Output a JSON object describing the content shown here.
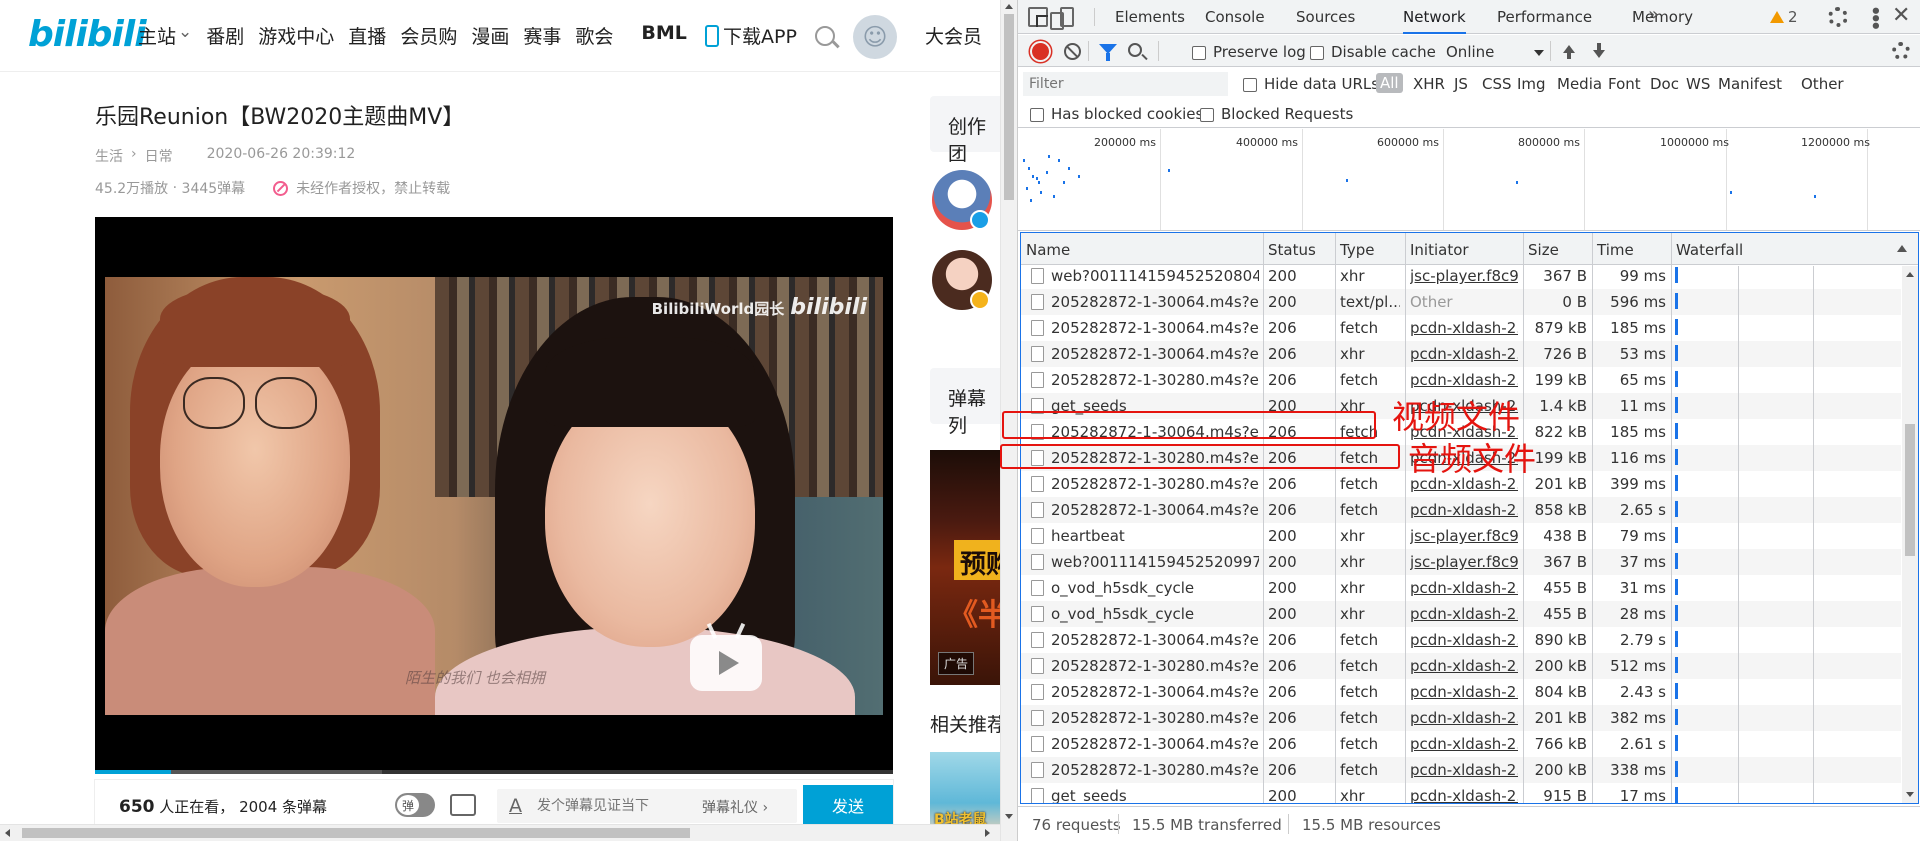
{
  "site": {
    "logo": "bilibili",
    "nav": [
      "主站",
      "番剧",
      "游戏中心",
      "直播",
      "会员购",
      "漫画",
      "赛事",
      "歌会"
    ],
    "nav_bml": "BML",
    "download_app": "下载APP",
    "vip": "大会员",
    "video": {
      "title": "乐园Reunion【BW2020主题曲MV】",
      "category": "生活",
      "subcategory": "日常",
      "date": "2020-06-26 20:39:12",
      "plays": "45.2万播放",
      "danmaku_count": "3445弹幕",
      "copyright": "未经作者授权，禁止转载",
      "watermark_text": "BilibiliWorld园长",
      "watermark_logo": "bilibili",
      "subtitle_overlay": "陌生的我们 也会相拥",
      "progress_fraction": 0.095,
      "buffer_fraction": 0.36
    },
    "danmaku_bar": {
      "watching_count": "650",
      "watching_text": "人正在看，",
      "danmaku_total": "2004 条弹幕",
      "toggle_label": "弹",
      "input_icon": "A",
      "input_placeholder": "发个弹幕见证当下",
      "etiquette": "弹幕礼仪 ›",
      "send": "发送"
    },
    "right_column": {
      "creation_team": "创作团",
      "danmaku_list": "弹幕列",
      "ad_text_1": "预购",
      "ad_text_2": "《半",
      "ad_tag": "广告",
      "related": "相关推荐",
      "related_thumb_text": "B站老鼠"
    }
  },
  "devtools": {
    "tabs": [
      "Elements",
      "Console",
      "Sources",
      "Network",
      "Performance",
      "Memory"
    ],
    "active_tab": "Network",
    "more_tabs": "»",
    "warnings": "2",
    "toolbar": {
      "preserve_log": "Preserve log",
      "disable_cache": "Disable cache",
      "throttling": "Online"
    },
    "filter": {
      "placeholder": "Filter",
      "hide_data_urls": "Hide data URLs",
      "types": [
        "All",
        "XHR",
        "JS",
        "CSS",
        "Img",
        "Media",
        "Font",
        "Doc",
        "WS",
        "Manifest",
        "Other"
      ],
      "has_blocked_cookies": "Has blocked cookies",
      "blocked_requests": "Blocked Requests"
    },
    "overview_labels": [
      "200000 ms",
      "400000 ms",
      "600000 ms",
      "800000 ms",
      "1000000 ms",
      "1200000 ms"
    ],
    "columns": [
      "Name",
      "Status",
      "Type",
      "Initiator",
      "Size",
      "Time",
      "Waterfall"
    ],
    "requests": [
      {
        "name": "web?0011141594525208047...",
        "status": "200",
        "type": "xhr",
        "initiator": "jsc-player.f8c9...",
        "size": "367 B",
        "time": "99 ms"
      },
      {
        "name": "205282872-1-30064.m4s?exp...",
        "status": "200",
        "type": "text/pl...",
        "initiator": "Other",
        "size": "0 B",
        "time": "596 ms"
      },
      {
        "name": "205282872-1-30064.m4s?exp...",
        "status": "206",
        "type": "fetch",
        "initiator": "pcdn-xldash-2...",
        "size": "879 kB",
        "time": "185 ms"
      },
      {
        "name": "205282872-1-30064.m4s?exp...",
        "status": "206",
        "type": "xhr",
        "initiator": "pcdn-xldash-2...",
        "size": "726 B",
        "time": "53 ms"
      },
      {
        "name": "205282872-1-30280.m4s?exp...",
        "status": "206",
        "type": "fetch",
        "initiator": "pcdn-xldash-2...",
        "size": "199 kB",
        "time": "65 ms"
      },
      {
        "name": "get_seeds",
        "status": "200",
        "type": "xhr",
        "initiator": "pcdn-xldash-2...",
        "size": "1.4 kB",
        "time": "11 ms"
      },
      {
        "name": "205282872-1-30064.m4s?exp...",
        "status": "206",
        "type": "fetch",
        "initiator": "pcdn-xldash-2...",
        "size": "822 kB",
        "time": "185 ms"
      },
      {
        "name": "205282872-1-30280.m4s?exp...",
        "status": "206",
        "type": "fetch",
        "initiator": "pcdn-xldash-2...",
        "size": "199 kB",
        "time": "116 ms"
      },
      {
        "name": "205282872-1-30280.m4s?exp...",
        "status": "206",
        "type": "fetch",
        "initiator": "pcdn-xldash-2...",
        "size": "201 kB",
        "time": "399 ms"
      },
      {
        "name": "205282872-1-30064.m4s?exp...",
        "status": "206",
        "type": "fetch",
        "initiator": "pcdn-xldash-2...",
        "size": "858 kB",
        "time": "2.65 s"
      },
      {
        "name": "heartbeat",
        "status": "200",
        "type": "xhr",
        "initiator": "jsc-player.f8c9...",
        "size": "438 B",
        "time": "79 ms"
      },
      {
        "name": "web?0011141594525209977...",
        "status": "200",
        "type": "xhr",
        "initiator": "jsc-player.f8c9...",
        "size": "367 B",
        "time": "37 ms"
      },
      {
        "name": "o_vod_h5sdk_cycle",
        "status": "200",
        "type": "xhr",
        "initiator": "pcdn-xldash-2...",
        "size": "455 B",
        "time": "31 ms"
      },
      {
        "name": "o_vod_h5sdk_cycle",
        "status": "200",
        "type": "xhr",
        "initiator": "pcdn-xldash-2...",
        "size": "455 B",
        "time": "28 ms"
      },
      {
        "name": "205282872-1-30064.m4s?exp...",
        "status": "206",
        "type": "fetch",
        "initiator": "pcdn-xldash-2...",
        "size": "890 kB",
        "time": "2.79 s"
      },
      {
        "name": "205282872-1-30280.m4s?exp...",
        "status": "206",
        "type": "fetch",
        "initiator": "pcdn-xldash-2...",
        "size": "200 kB",
        "time": "512 ms"
      },
      {
        "name": "205282872-1-30064.m4s?exp...",
        "status": "206",
        "type": "fetch",
        "initiator": "pcdn-xldash-2...",
        "size": "804 kB",
        "time": "2.43 s"
      },
      {
        "name": "205282872-1-30280.m4s?exp...",
        "status": "206",
        "type": "fetch",
        "initiator": "pcdn-xldash-2...",
        "size": "201 kB",
        "time": "382 ms"
      },
      {
        "name": "205282872-1-30064.m4s?exp...",
        "status": "206",
        "type": "fetch",
        "initiator": "pcdn-xldash-2...",
        "size": "766 kB",
        "time": "2.61 s"
      },
      {
        "name": "205282872-1-30280.m4s?exp...",
        "status": "206",
        "type": "fetch",
        "initiator": "pcdn-xldash-2...",
        "size": "200 kB",
        "time": "338 ms"
      },
      {
        "name": "get_seeds",
        "status": "200",
        "type": "xhr",
        "initiator": "pcdn-xldash-2...",
        "size": "915 B",
        "time": "17 ms"
      }
    ],
    "status_bar": {
      "requests": "76 requests",
      "transferred": "15.5 MB transferred",
      "resources": "15.5 MB resources"
    }
  },
  "annotations": {
    "video_file": "视频文件",
    "audio_file": "音频文件",
    "color": "#e5140f"
  }
}
